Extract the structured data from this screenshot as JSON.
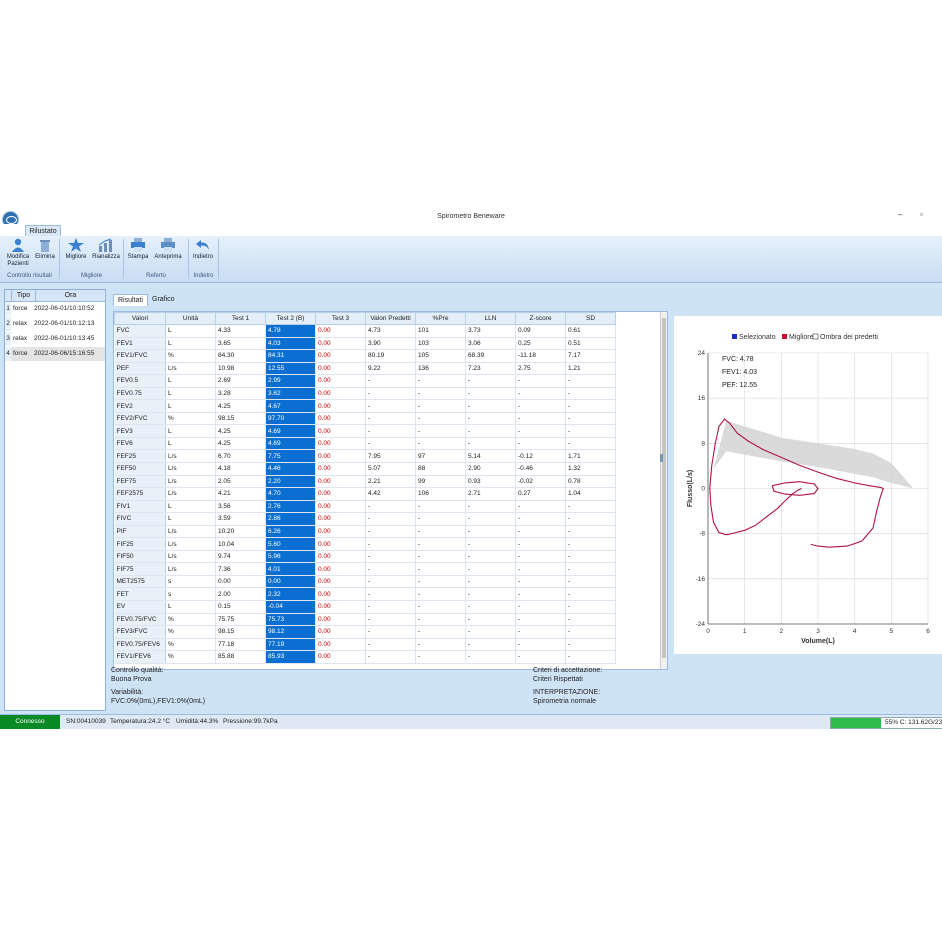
{
  "window": {
    "title": "Spirometro Beneware",
    "minimize": "–",
    "restore": "▫"
  },
  "ribbon": {
    "tab": "Rilustato",
    "buttons": {
      "modifica": "Modifica\nPazienti",
      "elimina": "Elimina",
      "migliore": "Migliore",
      "rianalizza": "Rianalizza",
      "stampa": "Stampa",
      "anteprima": "Anteprima",
      "indietro": "Indietro"
    },
    "groups": {
      "controllo": "Controllo risultati",
      "migliore": "Migliore",
      "referto": "Referto",
      "indietro": "Indietro"
    }
  },
  "tests_list": {
    "headers": [
      "Tipo",
      "Ora"
    ],
    "rows": [
      {
        "num": "1",
        "tipo": "force",
        "ora": "2022-06-01/10:10:52"
      },
      {
        "num": "2",
        "tipo": "relax",
        "ora": "2022-06-01/10:12:13"
      },
      {
        "num": "3",
        "tipo": "relax",
        "ora": "2022-06-01/10:13:45"
      },
      {
        "num": "4",
        "tipo": "force",
        "ora": "2022-06-06/15:16:55"
      }
    ]
  },
  "tabs": {
    "risultati": "Risultati",
    "grafico": "Grafico"
  },
  "results": {
    "headers": [
      "Valori",
      "Unità",
      "Test 1",
      "Test 2 (B)",
      "Test 3",
      "Valori Predetti",
      "%Pre",
      "LLN",
      "Z-score",
      "SD"
    ],
    "rows": [
      [
        "FVC",
        "L",
        "4.33",
        "4.78",
        "0.00",
        "4.73",
        "101",
        "3.73",
        "0.09",
        "0.61"
      ],
      [
        "FEV1",
        "L",
        "3.65",
        "4.03",
        "0.00",
        "3.90",
        "103",
        "3.06",
        "0.25",
        "0.51"
      ],
      [
        "FEV1/FVC",
        "%",
        "84.30",
        "84.31",
        "0.00",
        "80.19",
        "105",
        "68.39",
        "-11.18",
        "7.17"
      ],
      [
        "PEF",
        "L/s",
        "10.98",
        "12.55",
        "0.00",
        "9.22",
        "136",
        "7.23",
        "2.75",
        "1.21"
      ],
      [
        "FEV0.5",
        "L",
        "2.69",
        "2.99",
        "0.00",
        "-",
        "-",
        "-",
        "-",
        "-"
      ],
      [
        "FEV0.75",
        "L",
        "3.28",
        "3.62",
        "0.00",
        "-",
        "-",
        "-",
        "-",
        "-"
      ],
      [
        "FEV2",
        "L",
        "4.25",
        "4.67",
        "0.00",
        "-",
        "-",
        "-",
        "-",
        "-"
      ],
      [
        "FEV2/FVC",
        "%",
        "98.15",
        "97.70",
        "0.00",
        "-",
        "-",
        "-",
        "-",
        "-"
      ],
      [
        "FEV3",
        "L",
        "4.25",
        "4.69",
        "0.00",
        "-",
        "-",
        "-",
        "-",
        "-"
      ],
      [
        "FEV6",
        "L",
        "4.25",
        "4.69",
        "0.00",
        "-",
        "-",
        "-",
        "-",
        "-"
      ],
      [
        "FEF25",
        "L/s",
        "6.70",
        "7.75",
        "0.00",
        "7.95",
        "97",
        "5.14",
        "-0.12",
        "1.71"
      ],
      [
        "FEF50",
        "L/s",
        "4.18",
        "4.46",
        "0.00",
        "5.07",
        "88",
        "2.90",
        "-0.46",
        "1.32"
      ],
      [
        "FEF75",
        "L/s",
        "2.05",
        "2.20",
        "0.00",
        "2.21",
        "99",
        "0.93",
        "-0.02",
        "0.78"
      ],
      [
        "FEF2575",
        "L/s",
        "4.21",
        "4.70",
        "0.00",
        "4.42",
        "106",
        "2.71",
        "0.27",
        "1.04"
      ],
      [
        "FIV1",
        "L",
        "3.56",
        "2.76",
        "0.00",
        "-",
        "-",
        "-",
        "-",
        "-"
      ],
      [
        "FIVC",
        "L",
        "3.59",
        "2.86",
        "0.00",
        "-",
        "-",
        "-",
        "-",
        "-"
      ],
      [
        "PIF",
        "L/s",
        "10.20",
        "6.26",
        "0.00",
        "-",
        "-",
        "-",
        "-",
        "-"
      ],
      [
        "FIF25",
        "L/s",
        "10.04",
        "5.60",
        "0.00",
        "-",
        "-",
        "-",
        "-",
        "-"
      ],
      [
        "FIF50",
        "L/s",
        "9.74",
        "5.96",
        "0.00",
        "-",
        "-",
        "-",
        "-",
        "-"
      ],
      [
        "FIF75",
        "L/s",
        "7.36",
        "4.01",
        "0.00",
        "-",
        "-",
        "-",
        "-",
        "-"
      ],
      [
        "MET2575",
        "s",
        "0.00",
        "0.00",
        "0.00",
        "-",
        "-",
        "-",
        "-",
        "-"
      ],
      [
        "FET",
        "s",
        "2.00",
        "2.32",
        "0.00",
        "-",
        "-",
        "-",
        "-",
        "-"
      ],
      [
        "EV",
        "L",
        "0.15",
        "-0.04",
        "0.00",
        "-",
        "-",
        "-",
        "-",
        "-"
      ],
      [
        "FEV0.75/FVC",
        "%",
        "75.75",
        "75.73",
        "0.00",
        "-",
        "-",
        "-",
        "-",
        "-"
      ],
      [
        "FEV3/FVC",
        "%",
        "98.15",
        "98.12",
        "0.00",
        "-",
        "-",
        "-",
        "-",
        "-"
      ],
      [
        "FEV0.75/FEV6",
        "%",
        "77.18",
        "77.19",
        "0.00",
        "-",
        "-",
        "-",
        "-",
        "-"
      ],
      [
        "FEV1/FEV6",
        "%",
        "85.88",
        "85.93",
        "0.00",
        "-",
        "-",
        "-",
        "-",
        "-"
      ]
    ]
  },
  "chart": {
    "legend": [
      "Selezionato",
      "Migliore",
      "Ombra dei predetti"
    ],
    "legend_colors": [
      "#1a2fbf",
      "#c8102e",
      "#ffffff"
    ],
    "annotations": [
      "FVC: 4.78",
      "FEV1: 4.03",
      "PEF: 12.55"
    ]
  },
  "chart_data": {
    "type": "line",
    "xlabel": "Volume(L)",
    "ylabel": "Flusso(L/s)",
    "xlim": [
      0,
      6
    ],
    "ylim": [
      -24,
      24
    ],
    "xticks": [
      "0",
      "1",
      "2",
      "3",
      "4",
      "5",
      "6"
    ],
    "yticks": [
      "24",
      "16",
      "8",
      "0",
      "-8",
      "-16",
      "-24"
    ],
    "series": [
      {
        "name": "Migliore",
        "color": "#b0124a",
        "x": [
          0.05,
          0.1,
          0.2,
          0.3,
          0.45,
          0.6,
          0.8,
          1.1,
          1.5,
          2.0,
          2.5,
          3.0,
          3.5,
          4.0,
          4.4,
          4.7,
          4.78,
          4.7,
          4.6,
          4.5,
          4.2,
          3.8,
          3.3,
          3.0,
          2.8
        ],
        "y": [
          0,
          4,
          8,
          11,
          12.3,
          11.5,
          9.8,
          8.4,
          6.9,
          5.5,
          4.1,
          2.9,
          1.8,
          1.0,
          0.5,
          0.2,
          0,
          -1.5,
          -4,
          -7,
          -9.3,
          -10.2,
          -10.4,
          -10.2,
          -9.9
        ]
      },
      {
        "name": "Migliore (inspiratoria)",
        "color": "#b0124a",
        "x": [
          0.05,
          0.08,
          0.15,
          0.3,
          0.5,
          0.7,
          1.0,
          1.3,
          1.6,
          1.9,
          2.1,
          2.3,
          2.45,
          2.55
        ],
        "y": [
          0,
          -3,
          -6,
          -7.8,
          -8.2,
          -7.9,
          -7.4,
          -6.5,
          -5.0,
          -3.5,
          -2.2,
          -1.0,
          -0.3,
          0
        ]
      },
      {
        "name": "Ripetizione",
        "color": "#b0124a",
        "x": [
          1.75,
          2.1,
          2.5,
          2.9,
          3.0,
          2.9,
          2.5,
          2.1,
          1.8,
          1.75
        ],
        "y": [
          0.5,
          1.0,
          1.2,
          0.8,
          0,
          -0.9,
          -1.2,
          -1.0,
          -0.5,
          0.5
        ]
      }
    ],
    "predicted_shadow": {
      "x": [
        0,
        0.5,
        1.0,
        1.5,
        2.0,
        2.5,
        3.0,
        3.5,
        4.0,
        4.5,
        5.0,
        5.6,
        5.0,
        4.5,
        4.0,
        3.5,
        3.0,
        2.5,
        2.0,
        1.5,
        1.0,
        0.5,
        0.1,
        0
      ],
      "y": [
        0,
        12,
        11,
        10,
        9,
        8.5,
        8.0,
        7.5,
        7.0,
        6.2,
        4.5,
        0,
        1.0,
        2.0,
        2.6,
        3.2,
        3.8,
        4.3,
        4.8,
        5.4,
        6.0,
        6.6,
        3,
        0
      ]
    }
  },
  "footer": {
    "qc_label": "Controllo qualità:",
    "qc_value": "Buona Prova",
    "variability_label": "Variabilità:",
    "variability_value": "FVC:0%(0mL),FEV1:0%(0mL)",
    "criteria_label": "Criteri di accettazione:",
    "criteria_value": "Criteri Rispettati",
    "interp_label": "INTERPRETAZIONE:",
    "interp_value": "Spirometria normale"
  },
  "status": {
    "connection": "Connesso",
    "serial": "SN:00410039",
    "temperature": "Temperatura:24.2 °C",
    "humidity": "Umidità:44.3%",
    "pressure": "Pressione:99.7kPa",
    "disk_text": "55%  C: 131.62G/23",
    "disk_percent": 45
  }
}
